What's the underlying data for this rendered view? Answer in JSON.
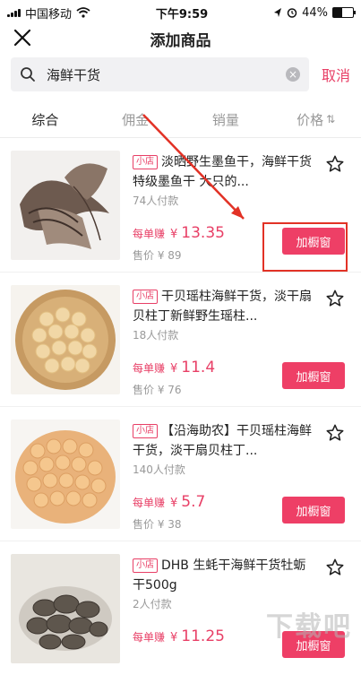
{
  "status_bar": {
    "carrier": "中国移动",
    "time": "下午9:59",
    "battery": "44%",
    "battery_level": 0.44
  },
  "header": {
    "title": "添加商品"
  },
  "search": {
    "query": "海鲜干货",
    "cancel_label": "取消"
  },
  "tabs": [
    {
      "label": "综合"
    },
    {
      "label": "佣金"
    },
    {
      "label": "销量"
    },
    {
      "label": "价格"
    }
  ],
  "products": [
    {
      "shop_tag": "小店",
      "title": "淡晒野生墨鱼干，海鲜干货特级墨鱼干 大只的...",
      "buyers": "74人付款",
      "earn_label": "每单赚",
      "yen": "¥",
      "earn_value": "13.35",
      "sale_price": "售价 ¥ 89",
      "add_label": "加橱窗"
    },
    {
      "shop_tag": "小店",
      "title": "干贝瑶柱海鲜干货，淡干扇贝柱丁新鲜野生瑶柱...",
      "buyers": "18人付款",
      "earn_label": "每单赚",
      "yen": "¥",
      "earn_value": "11.4",
      "sale_price": "售价 ¥ 76",
      "add_label": "加橱窗"
    },
    {
      "shop_tag": "小店",
      "title": "【沿海助农】干贝瑶柱海鲜干货，淡干扇贝柱丁...",
      "buyers": "140人付款",
      "earn_label": "每单赚",
      "yen": "¥",
      "earn_value": "5.7",
      "sale_price": "售价 ¥ 38",
      "add_label": "加橱窗"
    },
    {
      "shop_tag": "小店",
      "title": "DHB 生蚝干海鲜干货牡蛎干500g",
      "buyers": "2人付款",
      "earn_label": "每单赚",
      "yen": "¥",
      "earn_value": "11.25",
      "sale_price": "",
      "add_label": "加橱窗"
    }
  ],
  "colors": {
    "accent": "#ee3f66",
    "annotation": "#e23226"
  },
  "watermark": "下载吧"
}
